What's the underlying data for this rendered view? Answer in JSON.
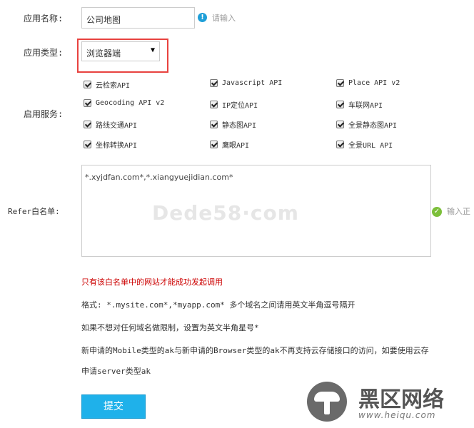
{
  "form": {
    "app_name_label": "应用名称:",
    "app_name_value": "公司地图",
    "app_name_hint": "请输入",
    "app_type_label": "应用类型:",
    "app_type_value": "浏览器端",
    "services_label": "启用服务:",
    "services": [
      {
        "label": "云检索API",
        "checked": true
      },
      {
        "label": "Javascript API",
        "checked": true
      },
      {
        "label": "Place API v2",
        "checked": true
      },
      {
        "label": "Geocoding API v2",
        "checked": true
      },
      {
        "label": "IP定位API",
        "checked": true
      },
      {
        "label": "车联网API",
        "checked": true
      },
      {
        "label": "路线交通API",
        "checked": true
      },
      {
        "label": "静态图API",
        "checked": true
      },
      {
        "label": "全景静态图API",
        "checked": true
      },
      {
        "label": "坐标转换API",
        "checked": true
      },
      {
        "label": "鹰眼API",
        "checked": true
      },
      {
        "label": "全景URL API",
        "checked": true
      }
    ],
    "refer_label": "Refer白名单:",
    "refer_value": "*.xyjdfan.com*,*.xiangyuejidian.com*",
    "refer_hint": "输入正",
    "warning": "只有该白名单中的网站才能成功发起调用",
    "format_note": "格式: *.mysite.com*,*myapp.com* 多个域名之间请用英文半角逗号隔开",
    "unlimited_note": "如果不想对任何域名做限制，设置为英文半角星号*",
    "mobile_note": "新申请的Mobile类型的ak与新申请的Browser类型的ak不再支持云存储接口的访问，如要使用云存",
    "server_note": "申请server类型ak",
    "submit_label": "提交"
  },
  "watermarks": {
    "dede": "Dede58·com",
    "heiqu_title": "黑区网络",
    "heiqu_url": "www.heiqu.com"
  },
  "colors": {
    "highlight_box": "#e8423f",
    "warning_text": "#cc0000",
    "submit_bg": "#1fb1ea",
    "hint_icon": "#1f9fd8",
    "ok_icon": "#7cbf3a"
  }
}
